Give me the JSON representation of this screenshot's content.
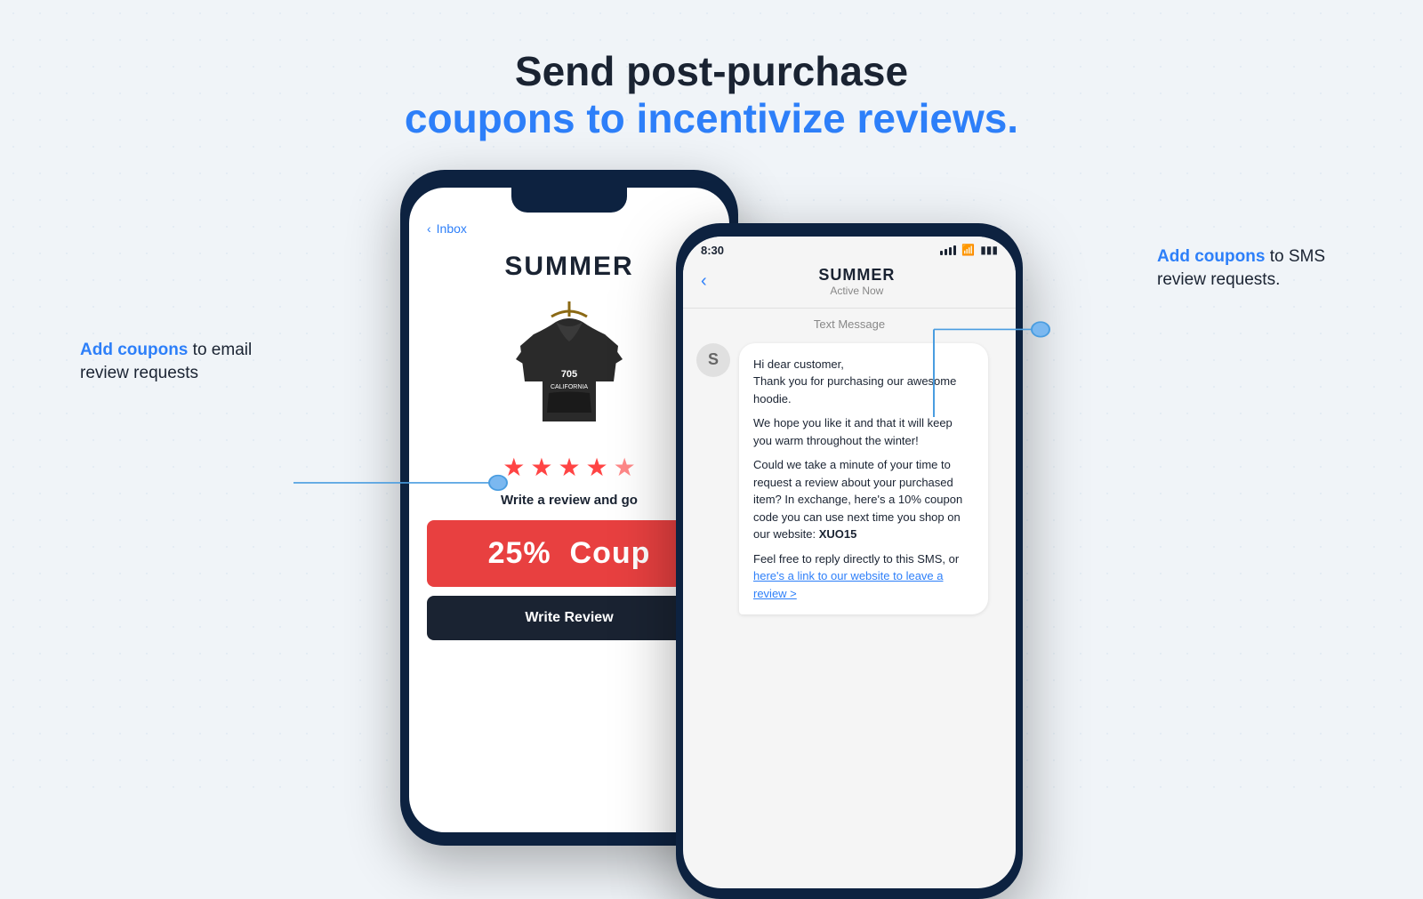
{
  "header": {
    "line1": "Send post-purchase",
    "line2": "coupons to incentivize reviews."
  },
  "annotation_left": {
    "highlight": "Add coupons",
    "rest": " to email\nreview requests"
  },
  "annotation_right": {
    "highlight": "Add coupons",
    "rest": " to SMS\nreview requests."
  },
  "email_phone": {
    "inbox_label": "Inbox",
    "brand": "SUMMER",
    "stars": [
      "★",
      "★",
      "★",
      "★",
      "★"
    ],
    "review_prompt": "Write a review and go",
    "coupon_text": "25%  Coup",
    "write_review_btn": "Write Review"
  },
  "sms_phone": {
    "time": "8:30",
    "contact_name": "SUMMER",
    "contact_status": "Active Now",
    "message_label": "Text Message",
    "avatar_letter": "S",
    "message_lines": [
      "Hi dear customer,",
      "Thank you for purchasing our awesome hoodie.",
      "We hope you like it and that it will keep you warm throughout the winter!",
      "Could we take a minute of your time to request a review about your purchased item? In exchange, here's a 10% coupon code you can use next time you shop on our website: XUO15",
      "Feel free to reply directly to this SMS, or here's a link to our website to leave a review >"
    ],
    "link_text": "here's a link to our website to leave a review >"
  }
}
